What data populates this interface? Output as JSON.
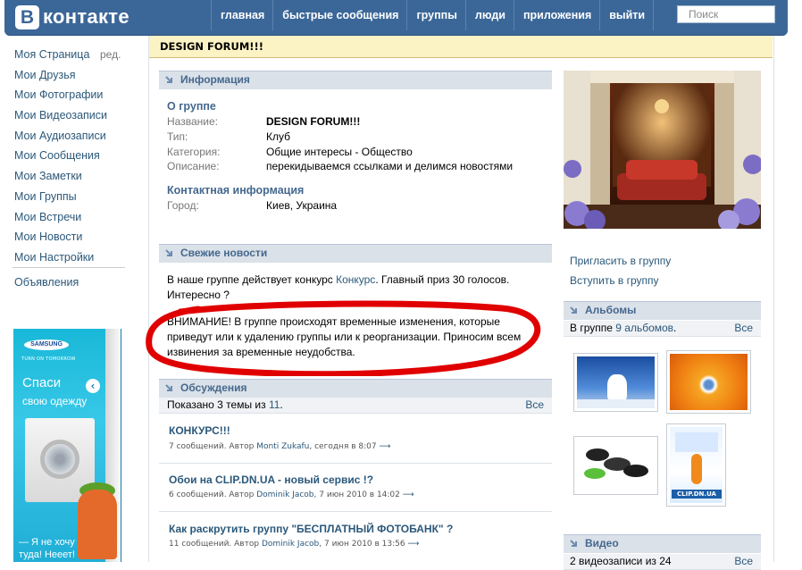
{
  "header": {
    "logo_letter": "В",
    "logo_text": "контакте",
    "nav": [
      "главная",
      "быстрые сообщения",
      "группы",
      "люди",
      "приложения",
      "выйти"
    ],
    "search_placeholder": "Поиск"
  },
  "left_menu": {
    "items": [
      "Моя Страница",
      "Мои Друзья",
      "Мои Фотографии",
      "Мои Видеозаписи",
      "Мои Аудиозаписи",
      "Мои Сообщения",
      "Мои Заметки",
      "Мои Группы",
      "Мои Встречи",
      "Мои Новости",
      "Мои Настройки"
    ],
    "edit_label": "ред.",
    "ads_label": "Объявления"
  },
  "banner": {
    "brand": "SAMSUNG",
    "slogan": "TURN ON TOMORROW",
    "line1": "Спаси",
    "line2": "свою одежду",
    "line3": "— Я не хочу",
    "line4": "туда! Нееет!"
  },
  "group": {
    "title": "DESIGN FORUM!!!"
  },
  "info": {
    "section_title": "Информация",
    "about_heading": "О группе",
    "rows": [
      {
        "label": "Название:",
        "value": "DESIGN FORUM!!!"
      },
      {
        "label": "Тип:",
        "value": "Клуб"
      },
      {
        "label": "Категория:",
        "value": "Общие интересы - Общество"
      },
      {
        "label": "Описание:",
        "value": "перекидываемся ссылками и делимся новостями"
      }
    ],
    "contact_heading": "Контактная информация",
    "city_label": "Город:",
    "city_value": "Киев, Украина"
  },
  "news": {
    "section_title": "Свежие новости",
    "p1_before": "В наше группе действует конкурс ",
    "p1_link": "Конкурс",
    "p1_after": ". Главный приз 30 голосов. Интересно ?",
    "p2": "ВНИМАНИЕ! В группе происходят временные изменения, которые приведут или к удалению группы или к реорганизации. Приносим всем извинения за временные неудобства."
  },
  "discussions": {
    "section_title": "Обсуждения",
    "shown_text": "Показано 3 темы из ",
    "shown_count": "11",
    "shown_end": ".",
    "all_label": "Все",
    "topics": [
      {
        "title": "КОНКУРС!!!",
        "meta_before": "7 сообщений. Автор ",
        "author": "Monti Zukafu",
        "date": ", сегодня в 8:07"
      },
      {
        "title": "Обои на CLIP.DN.UA - новый сервис !?",
        "meta_before": "6 сообщений. Автор ",
        "author": "Dominik Jacob",
        "date": ", 7 июн 2010 в 14:02"
      },
      {
        "title": "Как раскрутить группу \"БЕСПЛАТНЫЙ ФОТОБАНК\" ?",
        "meta_before": "11 сообщений. Автор ",
        "author": "Dominik Jacob",
        "date": ", 7 июн 2010 в 13:56"
      }
    ],
    "arrow": "⟶"
  },
  "right": {
    "invite": "Пригласить в группу",
    "join": "Вступить в группу",
    "albums_title": "Альбомы",
    "albums_text": "В группе ",
    "albums_count": "9 альбомов",
    "albums_end": ".",
    "albums_all": "Все",
    "video_title": "Видео",
    "video_text": "2 видеозаписи из 24",
    "video_all": "Все",
    "thumb4_text": "CLIP.DN.UA"
  },
  "colors": {
    "header_blue": "#3b6798",
    "link": "#2b587a",
    "section_bar": "#dae1e8",
    "group_title_bg": "#fbf3c4",
    "red_mark": "#e00000"
  }
}
